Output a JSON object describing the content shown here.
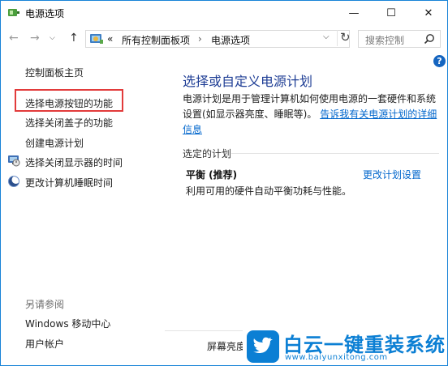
{
  "window": {
    "title": "电源选项",
    "minimize": "—",
    "maximize": "☐",
    "close": "✕"
  },
  "nav": {
    "back": "←",
    "forward": "→",
    "recent": "⌵",
    "up": "↑",
    "breadcrumb_sep": "«",
    "breadcrumbs": [
      "所有控制面板项",
      "电源选项"
    ],
    "crumb_arrow": "›",
    "dropdown": "⌵",
    "refresh": "↻",
    "search_placeholder": "搜索控制"
  },
  "sidebar": {
    "home": "控制面板主页",
    "links": [
      "选择电源按钮的功能",
      "选择关闭盖子的功能",
      "创建电源计划",
      "选择关闭显示器的时间",
      "更改计算机睡眠时间"
    ],
    "see_also_label": "另请参阅",
    "see_also": [
      "Windows 移动中心",
      "用户帐户"
    ]
  },
  "help": "?",
  "main": {
    "heading": "选择或自定义电源计划",
    "description": "电源计划是用于管理计算机如何使用电源的一套硬件和系统设置(如显示器亮度、睡眠等)。",
    "description_link": "告诉我有关电源计划的详细信息",
    "section_label": "选定的计划",
    "plan": {
      "name": "平衡 (推荐)",
      "edit_link": "更改计划设置",
      "description": "利用可用的硬件自动平衡功耗与性能。"
    },
    "bottom_label": "屏幕亮度"
  },
  "watermark": {
    "text": "白云一键重装系统",
    "url": "www.baiyunxitong.com"
  },
  "colors": {
    "heading": "#1f3e95",
    "link": "#0066cc",
    "highlight": "#e23b3b",
    "watermark": "#0b7fd4"
  }
}
